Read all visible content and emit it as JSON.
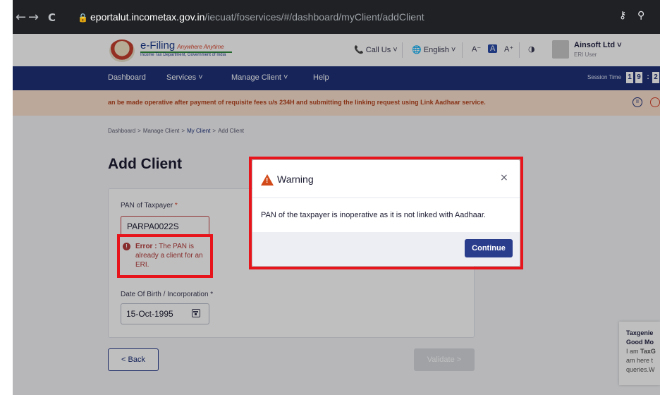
{
  "browser": {
    "back": "←",
    "forward": "→",
    "reload": "C",
    "lock": "🔒",
    "host": "eportalut.incometax.gov.in",
    "path": "/iecuat/foservices/#/dashboard/myClient/addClient",
    "key_icon": "key-icon",
    "zoom_icon": "zoom-icon"
  },
  "header": {
    "logo_title": "e-Filing",
    "logo_tagline": "Anywhere Anytime",
    "logo_subtitle": "Income Tax Department, Government of India",
    "call_us": "📞 Call Us ˅",
    "language": "🌐 English ˅",
    "font_decrease": "A⁻",
    "font_normal": "A",
    "font_increase": "A⁺",
    "contrast": "◑",
    "user_name": "Ainsoft Ltd ˅",
    "user_role": "ERI User"
  },
  "nav": {
    "items": [
      "Dashboard",
      "Services ˅",
      "Manage Client ˅",
      "Help"
    ],
    "session_label": "Session Time",
    "session_digits": [
      "1",
      "9",
      ":",
      "2"
    ]
  },
  "marquee": {
    "text": "an be made operative after payment of requisite fees u/s 234H and submitting the linking request using Link Aadhaar service.",
    "pause": "II"
  },
  "breadcrumb": {
    "items": [
      "Dashboard",
      "Manage Client",
      "My Client",
      "Add Client"
    ],
    "sep": ">"
  },
  "page": {
    "title": "Add Client"
  },
  "form": {
    "pan_label": "PAN of Taxpayer",
    "required_mark": "*",
    "pan_value": "PARPA0022S",
    "error_prefix": "Error :",
    "error_text": "The PAN is already a client for an ERI.",
    "error_icon": "!",
    "dob_label": "Date Of Birth / Incorporation",
    "dob_value": "15-Oct-1995"
  },
  "actions": {
    "back": "< Back",
    "validate": "Validate >"
  },
  "chat": {
    "line1": "Taxgenie",
    "line2": "Good Mo",
    "line3_prefix": "I am ",
    "line3_bold": "TaxG",
    "line4": "am here t",
    "line5": "queries.W"
  },
  "modal": {
    "title": "Warning",
    "warn_mark": "!",
    "close": "×",
    "message": "PAN of the taxpayer is inoperative as it is not linked with Aadhaar.",
    "continue": "Continue"
  },
  "colors": {
    "nav_bg": "#1e3178",
    "marquee_bg": "#fbe1cf",
    "annotation_red": "#e8141c",
    "primary_button": "#2a3c8c",
    "warning_orange": "#d24a19"
  }
}
